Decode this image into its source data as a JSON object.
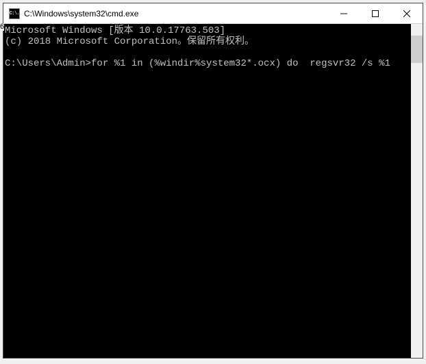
{
  "window": {
    "title": "C:\\Windows\\system32\\cmd.exe",
    "icon_text": "C:\\."
  },
  "page_indicator": "6",
  "terminal": {
    "line1": "Microsoft Windows [版本 10.0.17763.503]",
    "line2": "(c) 2018 Microsoft Corporation。保留所有权利。",
    "blank": "",
    "prompt_line": "C:\\Users\\Admin>for %1 in (%windir%system32*.ocx) do  regsvr32 /s %1"
  }
}
